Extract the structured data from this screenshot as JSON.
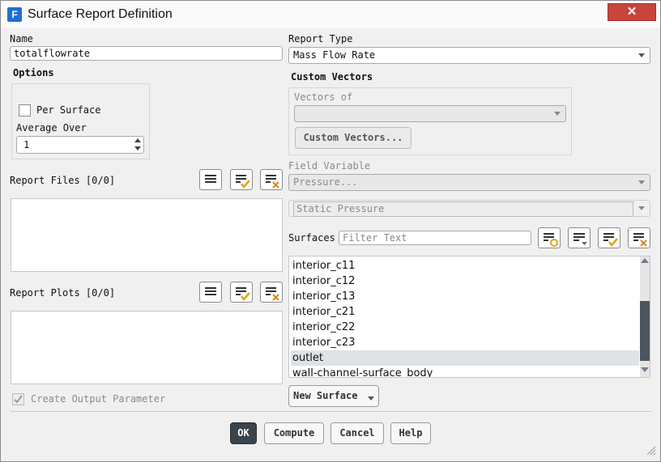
{
  "window": {
    "title": "Surface Report Definition",
    "app_icon_letter": "F",
    "close_glyph": "✕"
  },
  "name": {
    "label": "Name",
    "value": "totalflowrate"
  },
  "options": {
    "label": "Options",
    "per_surface_label": "Per Surface",
    "per_surface_checked": false,
    "average_over_label": "Average Over",
    "average_over_value": "1"
  },
  "report_files": {
    "label": "Report Files [0/0]",
    "items": []
  },
  "report_plots": {
    "label": "Report Plots [0/0]",
    "items": []
  },
  "create_output_parameter": {
    "label": "Create Output Parameter",
    "checked": true,
    "enabled": false
  },
  "report_type": {
    "label": "Report Type",
    "value": "Mass Flow Rate"
  },
  "custom_vectors": {
    "label": "Custom Vectors",
    "vectors_of_label": "Vectors of",
    "vectors_of_value": "",
    "button_label": "Custom Vectors..."
  },
  "field_variable": {
    "label": "Field Variable",
    "value": "Pressure...",
    "sub_value": "Static Pressure"
  },
  "surfaces": {
    "label": "Surfaces",
    "filter_placeholder": "Filter Text",
    "items": [
      "interior_c11",
      "interior_c12",
      "interior_c13",
      "interior_c21",
      "interior_c22",
      "interior_c23",
      "outlet",
      "wall-channel-surface_body"
    ],
    "selected": "outlet",
    "new_surface_label": "New Surface"
  },
  "buttons": {
    "ok": "OK",
    "compute": "Compute",
    "cancel": "Cancel",
    "help": "Help"
  },
  "colors": {
    "accent": "#1f6fd6",
    "close": "#c8453d",
    "ok_button": "#3b444b",
    "checkmark": "#e2a21b",
    "x_mark": "#d9871a"
  }
}
